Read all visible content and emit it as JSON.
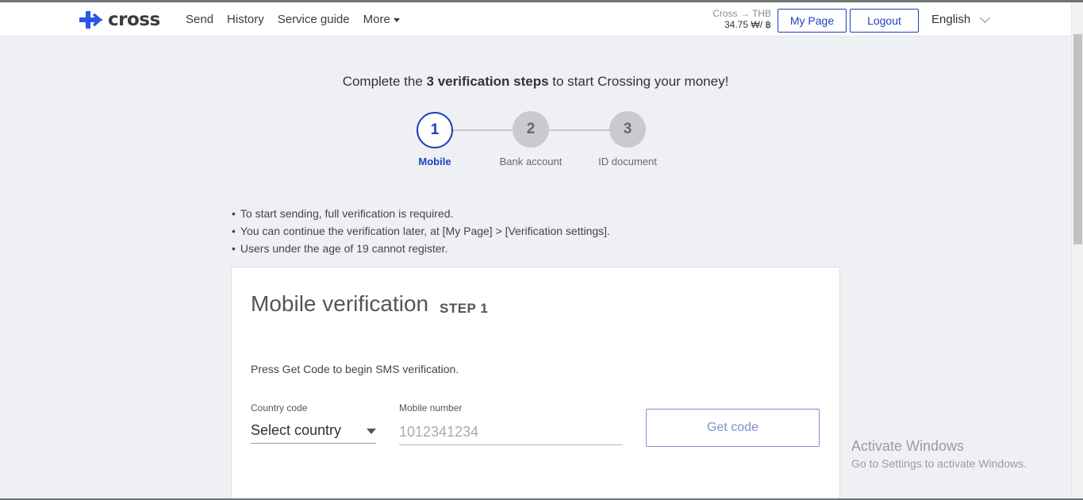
{
  "header": {
    "logo_text": "cross",
    "nav": [
      "Send",
      "History",
      "Service guide",
      "More"
    ],
    "rate_label": "Cross → THB",
    "rate_value": "34.75 ₩/ ฿",
    "mypage_label": "My Page",
    "logout_label": "Logout",
    "language": "English"
  },
  "verification": {
    "headline_pre": "Complete the ",
    "headline_bold": "3 verification steps",
    "headline_post": " to start Crossing your money!",
    "steps": [
      {
        "number": "1",
        "label": "Mobile",
        "state": "active"
      },
      {
        "number": "2",
        "label": "Bank account",
        "state": "inactive"
      },
      {
        "number": "3",
        "label": "ID document",
        "state": "inactive"
      }
    ],
    "notes": [
      "To start sending, full verification is required.",
      "You can continue the verification later, at [My Page] > [Verification settings].",
      "Users under the age of 19 cannot register."
    ]
  },
  "card": {
    "title": "Mobile verification",
    "step": "STEP 1",
    "description": "Press Get Code to begin SMS verification.",
    "country_label": "Country code",
    "country_value": "Select country",
    "mobile_label": "Mobile number",
    "mobile_placeholder": "1012341234",
    "get_code_label": "Get code"
  },
  "watermark": {
    "line1": "Activate Windows",
    "line2": "Go to Settings to activate Windows."
  },
  "colors": {
    "brand_blue": "#1f3fbf",
    "step_inactive": "#c9cacd",
    "background": "#eff0f3"
  }
}
